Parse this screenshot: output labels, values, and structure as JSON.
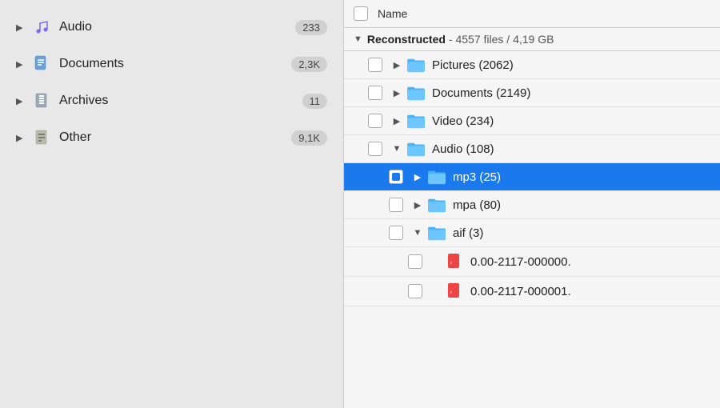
{
  "sidebar": {
    "items": [
      {
        "id": "audio",
        "label": "Audio",
        "badge": "233",
        "icon": "music",
        "expanded": false
      },
      {
        "id": "documents",
        "label": "Documents",
        "badge": "2,3K",
        "icon": "doc",
        "expanded": false
      },
      {
        "id": "archives",
        "label": "Archives",
        "badge": "11",
        "icon": "archive",
        "expanded": false
      },
      {
        "id": "other",
        "label": "Other",
        "badge": "9,1K",
        "icon": "other",
        "expanded": false
      }
    ]
  },
  "header": {
    "name_col": "Name"
  },
  "reconstructed": {
    "label": "Reconstructed",
    "info": "- 4557 files / 4,19 GB"
  },
  "file_tree": [
    {
      "id": "pictures",
      "label": "Pictures (2062)",
      "type": "folder",
      "indent": 1,
      "chevron": "▶",
      "selected": false
    },
    {
      "id": "documents",
      "label": "Documents (2149)",
      "type": "folder",
      "indent": 1,
      "chevron": "▶",
      "selected": false
    },
    {
      "id": "video",
      "label": "Video (234)",
      "type": "folder",
      "indent": 1,
      "chevron": "▶",
      "selected": false
    },
    {
      "id": "audio",
      "label": "Audio (108)",
      "type": "folder",
      "indent": 1,
      "chevron": "▼",
      "selected": false
    },
    {
      "id": "mp3",
      "label": "mp3 (25)",
      "type": "folder",
      "indent": 2,
      "chevron": "▶",
      "selected": true,
      "checked": true
    },
    {
      "id": "mpa",
      "label": "mpa (80)",
      "type": "folder",
      "indent": 2,
      "chevron": "▶",
      "selected": false
    },
    {
      "id": "aif",
      "label": "aif (3)",
      "type": "folder",
      "indent": 2,
      "chevron": "▼",
      "selected": false
    },
    {
      "id": "file1",
      "label": "0.00-2117-000000.",
      "type": "audio-file",
      "indent": 3,
      "chevron": "",
      "selected": false
    },
    {
      "id": "file2",
      "label": "0.00-2117-000001.",
      "type": "audio-file",
      "indent": 3,
      "chevron": "",
      "selected": false
    }
  ]
}
